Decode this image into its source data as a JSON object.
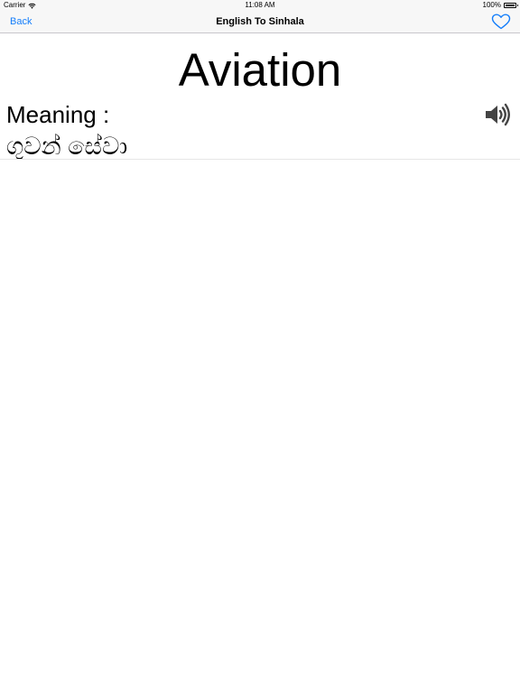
{
  "status_bar": {
    "carrier": "Carrier",
    "time": "11:08 AM",
    "battery_percent": "100%",
    "battery_level": 1.0
  },
  "nav": {
    "back_label": "Back",
    "title": "English To Sinhala",
    "favorite_icon": "heart-outline-icon",
    "accent_color": "#147efb"
  },
  "word": {
    "term": "Aviation",
    "meaning_label": "Meaning :",
    "meaning": "ගුවන් සේවා",
    "speaker_icon": "speaker-icon"
  }
}
